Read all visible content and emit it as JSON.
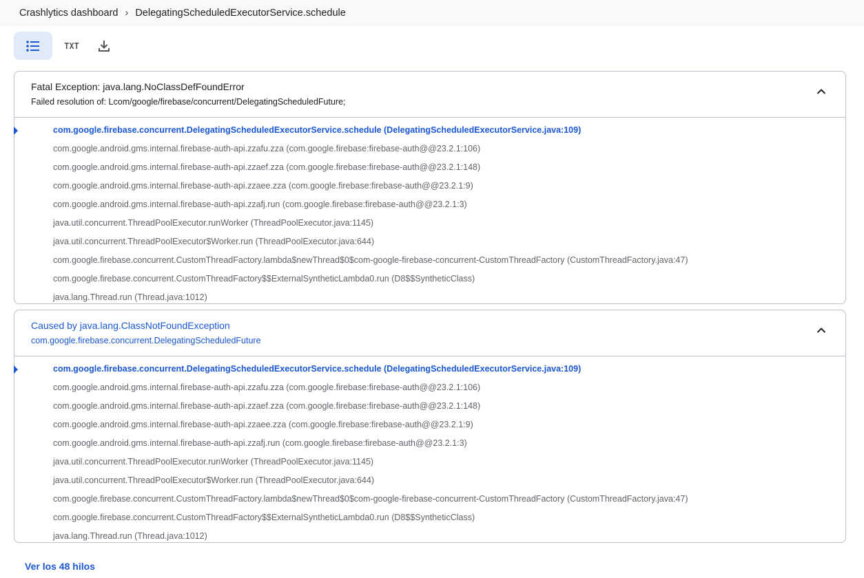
{
  "breadcrumb": {
    "root": "Crashlytics dashboard",
    "separator": "›",
    "current": "DelegatingScheduledExecutorService.schedule"
  },
  "toolbar": {
    "list_icon": "list-icon",
    "txt_label": "TXT",
    "download_icon": "download-icon"
  },
  "panels": [
    {
      "title": "Fatal Exception: java.lang.NoClassDefFoundError",
      "subtitle": "Failed resolution of: Lcom/google/firebase/concurrent/DelegatingScheduledFuture;",
      "frames": [
        "com.google.firebase.concurrent.DelegatingScheduledExecutorService.schedule (DelegatingScheduledExecutorService.java:109)",
        "com.google.android.gms.internal.firebase-auth-api.zzafu.zza (com.google.firebase:firebase-auth@@23.2.1:106)",
        "com.google.android.gms.internal.firebase-auth-api.zzaef.zza (com.google.firebase:firebase-auth@@23.2.1:148)",
        "com.google.android.gms.internal.firebase-auth-api.zzaee.zza (com.google.firebase:firebase-auth@@23.2.1:9)",
        "com.google.android.gms.internal.firebase-auth-api.zzafj.run (com.google.firebase:firebase-auth@@23.2.1:3)",
        "java.util.concurrent.ThreadPoolExecutor.runWorker (ThreadPoolExecutor.java:1145)",
        "java.util.concurrent.ThreadPoolExecutor$Worker.run (ThreadPoolExecutor.java:644)",
        "com.google.firebase.concurrent.CustomThreadFactory.lambda$newThread$0$com-google-firebase-concurrent-CustomThreadFactory (CustomThreadFactory.java:47)",
        "com.google.firebase.concurrent.CustomThreadFactory$$ExternalSyntheticLambda0.run (D8$$SyntheticClass)",
        "java.lang.Thread.run (Thread.java:1012)"
      ]
    },
    {
      "title": "Caused by java.lang.ClassNotFoundException",
      "subtitle": "com.google.firebase.concurrent.DelegatingScheduledFuture",
      "frames": [
        "com.google.firebase.concurrent.DelegatingScheduledExecutorService.schedule (DelegatingScheduledExecutorService.java:109)",
        "com.google.android.gms.internal.firebase-auth-api.zzafu.zza (com.google.firebase:firebase-auth@@23.2.1:106)",
        "com.google.android.gms.internal.firebase-auth-api.zzaef.zza (com.google.firebase:firebase-auth@@23.2.1:148)",
        "com.google.android.gms.internal.firebase-auth-api.zzaee.zza (com.google.firebase:firebase-auth@@23.2.1:9)",
        "com.google.android.gms.internal.firebase-auth-api.zzafj.run (com.google.firebase:firebase-auth@@23.2.1:3)",
        "java.util.concurrent.ThreadPoolExecutor.runWorker (ThreadPoolExecutor.java:1145)",
        "java.util.concurrent.ThreadPoolExecutor$Worker.run (ThreadPoolExecutor.java:644)",
        "com.google.firebase.concurrent.CustomThreadFactory.lambda$newThread$0$com-google-firebase-concurrent-CustomThreadFactory (CustomThreadFactory.java:47)",
        "com.google.firebase.concurrent.CustomThreadFactory$$ExternalSyntheticLambda0.run (D8$$SyntheticClass)",
        "java.lang.Thread.run (Thread.java:1012)"
      ]
    }
  ],
  "more_link": "Ver los 48 hilos",
  "colors": {
    "accent": "#1a57d0",
    "muted": "#5f6368",
    "border": "#b9c1cc"
  }
}
